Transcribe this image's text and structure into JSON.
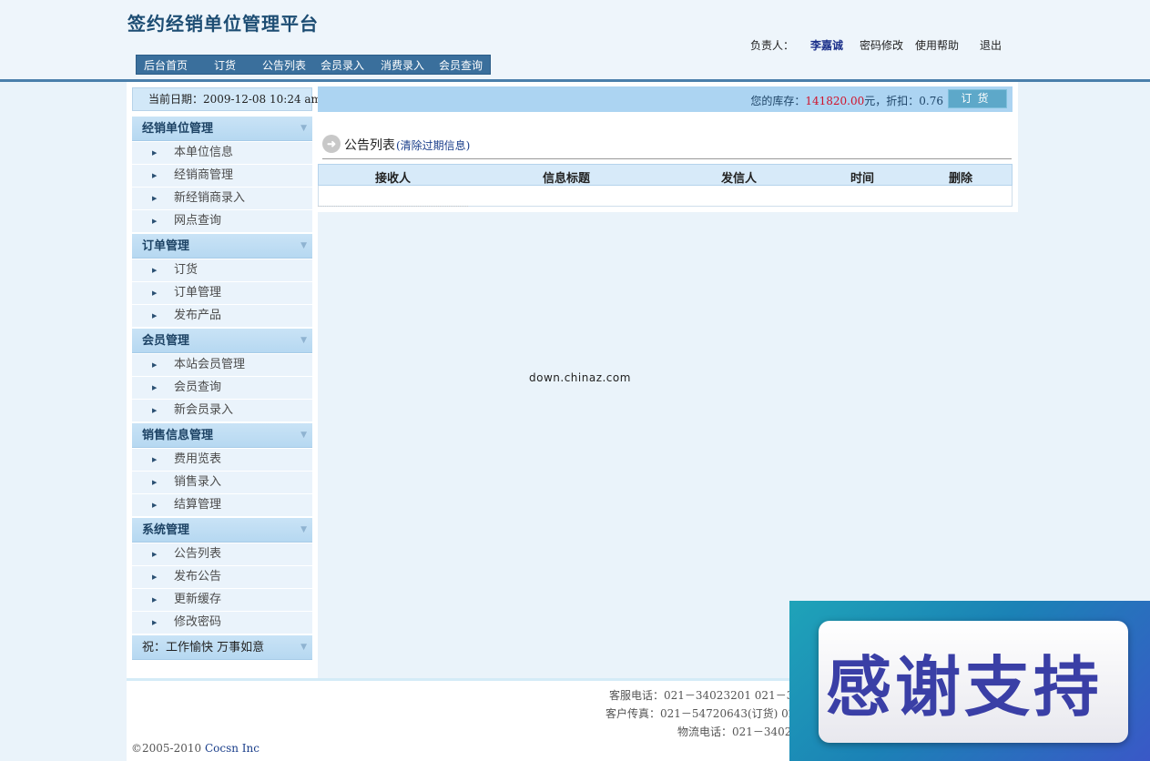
{
  "header": {
    "title": "签约经销单位管理平台",
    "owner_label": "负责人：",
    "owner_name": "李嘉诚",
    "links": [
      "密码修改",
      "使用帮助",
      "退出"
    ]
  },
  "nav": {
    "items": [
      "后台首页",
      "订货",
      "公告列表",
      "会员录入",
      "消费录入",
      "会员查询"
    ]
  },
  "sidebar": {
    "date_text": "当前日期：2009-12-08 10:24 am",
    "groups": [
      {
        "title": "经销单位管理",
        "items": [
          "本单位信息",
          "经销商管理",
          "新经销商录入",
          "网点查询"
        ]
      },
      {
        "title": "订单管理",
        "items": [
          "订货",
          "订单管理",
          "发布产品"
        ]
      },
      {
        "title": "会员管理",
        "items": [
          "本站会员管理",
          "会员查询",
          "新会员录入"
        ]
      },
      {
        "title": "销售信息管理",
        "items": [
          "费用览表",
          "销售录入",
          "结算管理"
        ]
      },
      {
        "title": "系统管理",
        "items": [
          "公告列表",
          "发布公告",
          "更新缓存",
          "修改密码"
        ]
      }
    ],
    "greeting": "祝：工作愉快 万事如意"
  },
  "stock": {
    "label": "您的库存：",
    "amount": "141820.00",
    "unit": "元，折扣：",
    "discount": "0.76",
    "button": "订货"
  },
  "notice": {
    "title": "公告列表",
    "clear_link": "(清除过期信息)",
    "columns": [
      "接收人",
      "信息标题",
      "发信人",
      "时间",
      "删除"
    ]
  },
  "watermark": "down.chinaz.com",
  "footer": {
    "service_phone": "客服电话：021－34023201 021－3402",
    "fax": "客户传真：021－54720643(订货) 021－",
    "logistics": "物流电话：021－34028",
    "copyright_prefix": "©2005-2010 ",
    "company": "Cocsn Inc"
  },
  "overlay": {
    "text": "感谢支持"
  },
  "colors": {
    "nav_bg": "#3a6f9c",
    "accent_red": "#d0132b",
    "menu_head": "#c9e3f6"
  }
}
